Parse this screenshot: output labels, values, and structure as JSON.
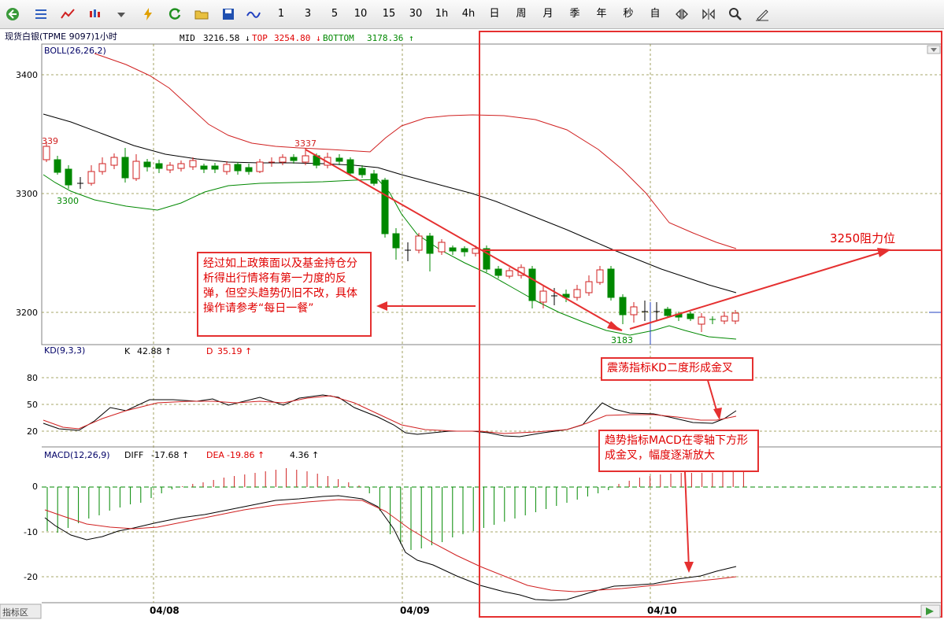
{
  "toolbar": {
    "period_buttons": [
      "1",
      "3",
      "5",
      "10",
      "15",
      "30",
      "1h",
      "4h",
      "日",
      "周",
      "月",
      "季",
      "年",
      "秒",
      "自"
    ]
  },
  "header": {
    "symbol": "现货白银(TPME 9097)1小时",
    "mid_label": "MID",
    "mid_value": "3216.58 ↓",
    "top_label": "TOP",
    "top_value": "3254.80 ↓",
    "bottom_label": "BOTTOM",
    "bottom_value": "3178.36 ↑"
  },
  "boll_panel": {
    "title": "BOLL(26,26,2)",
    "y_ticks": [
      "3400",
      "3300",
      "3200"
    ],
    "label_339": "339",
    "label_3337": "3337",
    "label_3300": "3300",
    "label_3183": "3183"
  },
  "kd_panel": {
    "title": "KD(9,3,3)",
    "k_label": "K",
    "k_value": "42.88 ↑",
    "d_label": "D",
    "d_value": "35.19 ↑",
    "y_ticks": [
      "80",
      "50",
      "20"
    ]
  },
  "macd_panel": {
    "title": "MACD(12,26,9)",
    "diff_label": "DIFF",
    "diff_value": "-17.68 ↑",
    "dea_label": "DEA",
    "dea_value": "-19.86 ↑",
    "macd_value": "4.36 ↑",
    "y_ticks": [
      "0",
      "-10",
      "-20"
    ]
  },
  "x_axis": {
    "dates": [
      "04/08",
      "04/09",
      "04/10"
    ]
  },
  "bottom_bar": {
    "indicator_tab": "指标区"
  },
  "annotations": {
    "policy_note": "经过如上政策面以及基金持仓分析得出行情将有第一力度的反弹，但空头趋势仍旧不改，具体操作请参考“每日一餐”",
    "resistance": "3250阻力位",
    "kd_note": "震荡指标KD二度形成金叉",
    "macd_note": "趋势指标MACD在零轴下方形成金叉，幅度逐渐放大"
  },
  "colors": {
    "up": "#e00000",
    "down": "#008800",
    "mid_line": "#000000",
    "annotation": "#e53030"
  }
}
